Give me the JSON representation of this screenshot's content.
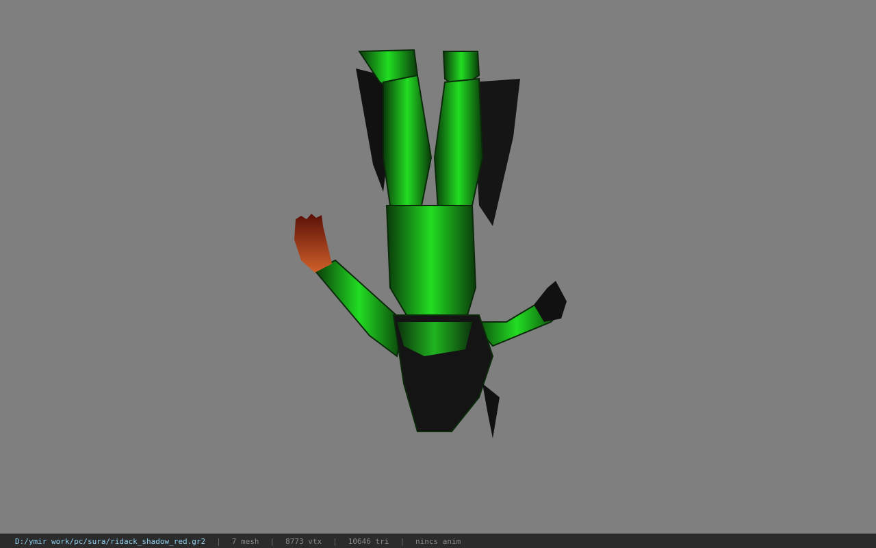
{
  "viewer": {
    "background_color": "#7f7f7f",
    "model_accent_color": "#22cc22",
    "model_name": "ridack_shadow_red character model (upside down)"
  },
  "statusbar": {
    "file_path": "D:/ymir work/pc/sura/ridack_shadow_red.gr2",
    "separator": "|",
    "mesh": "7 mesh",
    "vtx": "8773 vtx",
    "tri": "10646 tri",
    "anim": "nincs anim"
  }
}
